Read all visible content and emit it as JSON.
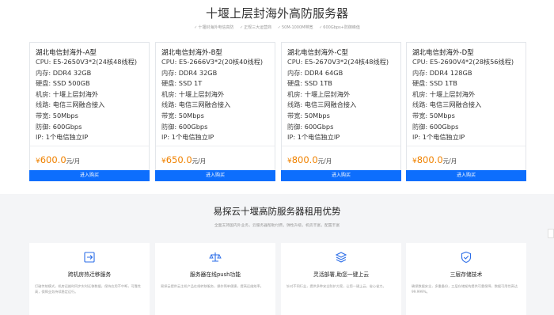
{
  "header": {
    "title": "十堰上层封海外高防服务器",
    "tags": [
      "十堰封海外电信高防",
      "正规三大运营商",
      "50M-1000M带宽",
      "600Gbps+防御峰值"
    ]
  },
  "labels": {
    "cpu": "CPU:",
    "memory": "内存:",
    "disk": "硬盘:",
    "room": "机房:",
    "line": "线路:",
    "bandwidth": "带宽:",
    "defense": "防御:",
    "ip": "IP:",
    "currency": "¥",
    "unit": "元/月",
    "buy": "进入购买"
  },
  "products": [
    {
      "name": "湖北电信封海外-A型",
      "cpu": "E5-2650V3*2(24核48线程)",
      "memory": "DDR4 32GB",
      "disk": "SSD 500GB",
      "room": "十堰上层封海外",
      "line": "电信三网融合接入",
      "bandwidth": "50Mbps",
      "defense": "600Gbps",
      "ip": "1个电信独立IP",
      "price": "600.0"
    },
    {
      "name": "湖北电信封海外-B型",
      "cpu": "E5-2666V3*2(20核40线程)",
      "memory": "DDR4 32GB",
      "disk": "SSD 1T",
      "room": "十堰上层封海外",
      "line": "电信三网融合接入",
      "bandwidth": "50Mbps",
      "defense": "600Gbps",
      "ip": "1个电信独立IP",
      "price": "650.0"
    },
    {
      "name": "湖北电信封海外-C型",
      "cpu": "E5-2670V3*2(24核48线程)",
      "memory": "DDR4 64GB",
      "disk": "SSD 1TB",
      "room": "十堰上层封海外",
      "line": "电信三网融合接入",
      "bandwidth": "50Mbps",
      "defense": "600Gbps",
      "ip": "1个电信独立IP",
      "price": "800.0"
    },
    {
      "name": "湖北电信封海外-D型",
      "cpu": "E5-2690V4*2(28核56线程)",
      "memory": "DDR4 128GB",
      "disk": "SSD 1TB",
      "room": "十堰上层封海外",
      "line": "电信三网融合接入",
      "bandwidth": "50Mbps",
      "defense": "600Gbps",
      "ip": "1个电信独立IP",
      "price": "800.0"
    }
  ],
  "advantages": {
    "title": "易探云十堰高防服务器租用优势",
    "subtitle": "全面支持国内外业务，云服务器帮助付费，弹性升级，机房丰富，配置丰富",
    "items": [
      {
        "title": "跨机房热迁移服务",
        "desc": "打破传统模式，机房运维时同步实时迁移数据，保持应用不中断，可靠性高，保障业务持续稳定运行。",
        "icon": "migrate-icon"
      },
      {
        "title": "服务器在线push功能",
        "desc": "易探云提供云主机产品在线转移服务，操作简单便捷，提高运维效率。",
        "icon": "balance-icon"
      },
      {
        "title": "灵活部署,助您一键上云",
        "desc": "针对不同行业，提供多种安全防护方案，让您一键上云，省心省力。",
        "icon": "layers-icon"
      },
      {
        "title": "三层存储技术",
        "desc": "确保数据安全，多重备份，三层存储架构提供可靠保障，数据可用性高达99.999%。",
        "icon": "shield-check-icon"
      }
    ]
  },
  "colors": {
    "accent": "#0d6efd",
    "price": "#f08200"
  }
}
